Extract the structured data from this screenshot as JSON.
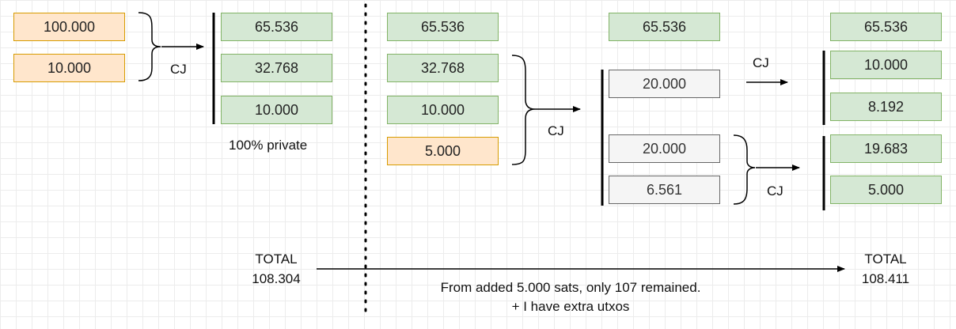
{
  "boxes": {
    "in1": "100.000",
    "in2": "10.000",
    "mix1_a": "65.536",
    "mix1_b": "32.768",
    "mix1_c": "10.000",
    "mid_a": "65.536",
    "mid_b": "32.768",
    "mid_c": "10.000",
    "mid_d": "5.000",
    "stage3_a": "65.536",
    "stage3_b": "20.000",
    "stage3_c": "20.000",
    "stage3_d": "6.561",
    "final_a": "65.536",
    "final_b": "10.000",
    "final_c": "8.192",
    "final_d": "19.683",
    "final_e": "5.000"
  },
  "labels": {
    "cj": "CJ",
    "private": "100% private",
    "total_left_title": "TOTAL",
    "total_left_value": "108.304",
    "total_right_title": "TOTAL",
    "total_right_value": "108.411",
    "note_line1": "From added 5.000 sats, only 107 remained.",
    "note_line2": "+ I have extra utxos"
  },
  "colors": {
    "green_fill": "#d5e8d4",
    "green_stroke": "#82b366",
    "orange_fill": "#ffe6cc",
    "orange_stroke": "#d79b00",
    "gray_fill": "#f5f5f5",
    "gray_stroke": "#666666"
  }
}
